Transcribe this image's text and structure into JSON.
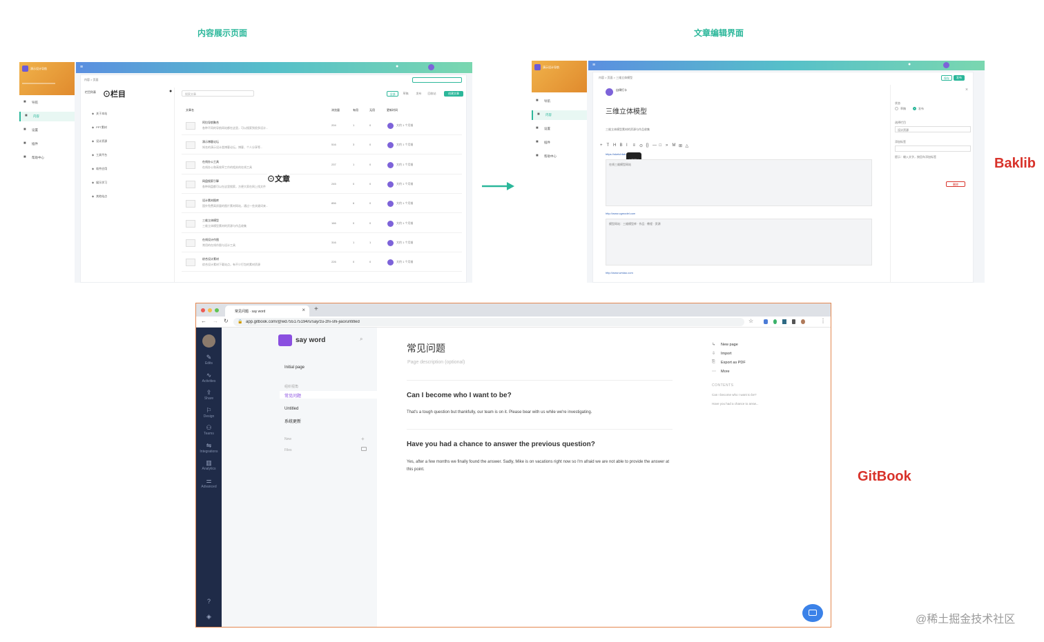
{
  "captions": {
    "left": "内容展示页面",
    "right": "文章编辑界面"
  },
  "brands": {
    "baklib": "Baklib",
    "gitbook": "GitBook"
  },
  "watermark": "@稀土掘金技术社区",
  "arrow_color": "#2bb79a",
  "left_panel": {
    "site_name": "演示设计导航",
    "breadcrumb": "内容 > 页面",
    "section_title": "栏目列表",
    "annot_column": "栏目",
    "annot_article": "文章",
    "search_placeholder": "搜索文章",
    "tabs": [
      "全部",
      "草稿",
      "发布",
      "回收站"
    ],
    "new_button": "创建文章",
    "sidebar_items": [
      "导航",
      "内容",
      "设置",
      "插件",
      "帮助中心"
    ],
    "columns": [
      "文章名",
      "浏览量",
      "有用",
      "无用",
      "更新时间"
    ],
    "tree_items": [
      "关于本站",
      "PPT素材",
      "设计资源",
      "工具平台",
      "软件应用",
      "娱乐学习",
      "其他站点"
    ],
    "rows": [
      {
        "title": "阿拉导航聚合",
        "desc": "各种不同的导航网站都在这里，可以搜索到很多设计...",
        "views": "204",
        "useful": "1",
        "useless": "0",
        "time": "大约 1 个月前"
      },
      {
        "title": "演示博客论坛",
        "desc": "知名的演示设计类博客论坛，博客、个人分享等...",
        "views": "516",
        "useful": "3",
        "useless": "0",
        "time": "大约 1 个月前"
      },
      {
        "title": "在线办公工具",
        "desc": "在线办公和高效率工作的相关的在线工具",
        "views": "237",
        "useful": "1",
        "useless": "0",
        "time": "大约 1 个月前"
      },
      {
        "title": "网盘搜索引擎",
        "desc": "各种网盘都可以在这里搜索，方便大家在网上找文件",
        "views": "245",
        "useful": "0",
        "useless": "0",
        "time": "大约 1 个月前"
      },
      {
        "title": "设计素材图库",
        "desc": "国外免费高质量的图片素材网站，通过一些关键词来...",
        "views": "856",
        "useful": "6",
        "useless": "0",
        "time": "大约 1 个月前"
      },
      {
        "title": "三维立体模型",
        "desc": "三维立体模型素材的资源与作品收集",
        "views": "166",
        "useful": "0",
        "useless": "0",
        "time": "大约 1 个月前"
      },
      {
        "title": "在线设计作图",
        "desc": "常用的在线作图与设计工具",
        "views": "316",
        "useful": "1",
        "useless": "1",
        "time": "大约 1 个月前"
      },
      {
        "title": "综合设计素材",
        "desc": "综合设计素材下载站点，有不少打包的素材资源",
        "views": "226",
        "useful": "0",
        "useless": "0",
        "time": "大约 1 个月前"
      }
    ]
  },
  "right_panel": {
    "site_name": "演示设计导航",
    "breadcrumb": "内容 > 页面 > 三维立体模型",
    "author": "自律打卡",
    "doc_title": "三维立体模型",
    "doc_subtitle": "三维立体模型素材的资源与作品收集",
    "link1": "https://sketchfab.com",
    "tooltip": "查看图片",
    "text1": "在线三维模型网站",
    "link2": "http://www.cgmodel.com",
    "text2": "模型网站：三维模型库 · 作品 · 教程 · 资源",
    "link3": "http://www.wmiao.com",
    "toolbar_icons": [
      "+",
      "T",
      "H",
      "B",
      "I",
      "≡",
      "⊙",
      "{}",
      "—",
      "□",
      "»",
      "M",
      "⊞",
      "△"
    ],
    "right_labels": [
      "状态",
      "选择栏目",
      "设计资源",
      "添加标签"
    ],
    "right_radio": [
      "草稿",
      "发布"
    ],
    "save_button": "保存",
    "publish_button": "发布",
    "delete_button": "删除",
    "hint": "提示：输入文字，按回车添加标签"
  },
  "gitbook": {
    "tab_title": "常见问题 · say word",
    "url": "app.gitbook.com/@wd755175194/s/say/zu-zhi-shi-jiao/untitled",
    "space_name": "say word",
    "nav_icons": [
      {
        "icon": "✎",
        "label": "Edits"
      },
      {
        "icon": "∿",
        "label": "Activities"
      },
      {
        "icon": "⇪",
        "label": "Share"
      },
      {
        "icon": "⚐",
        "label": "Design"
      },
      {
        "icon": "⚇",
        "label": "Teams"
      },
      {
        "icon": "⇋",
        "label": "Integrations"
      },
      {
        "icon": "▥",
        "label": "Analytics"
      },
      {
        "icon": "⚌",
        "label": "Advanced"
      }
    ],
    "pages": {
      "initial": "Initial page",
      "group": "组织视角",
      "active": "常见问题",
      "untitled": "Untitled",
      "system": "系统更新",
      "new": "New",
      "files": "Files"
    },
    "doc": {
      "title": "常见问题",
      "desc": "Page description (optional)",
      "q1": "Can I become who I want to be?",
      "a1": "That's a tough question but thankfully, our team is on it. Please bear with us while we're investigating.",
      "q2": "Have you had a chance to answer the previous question?",
      "a2": "Yes, after a few months we finally found the answer. Sadly, Mike is on vacations right now so I'm afraid we are not able to provide the answer at this point."
    },
    "actions": [
      "New page",
      "Import",
      "Export as PDF",
      "More"
    ],
    "contents_title": "CONTENTS",
    "contents": [
      "Can I become who I want to be?",
      "Have you had a chance to answ..."
    ]
  }
}
